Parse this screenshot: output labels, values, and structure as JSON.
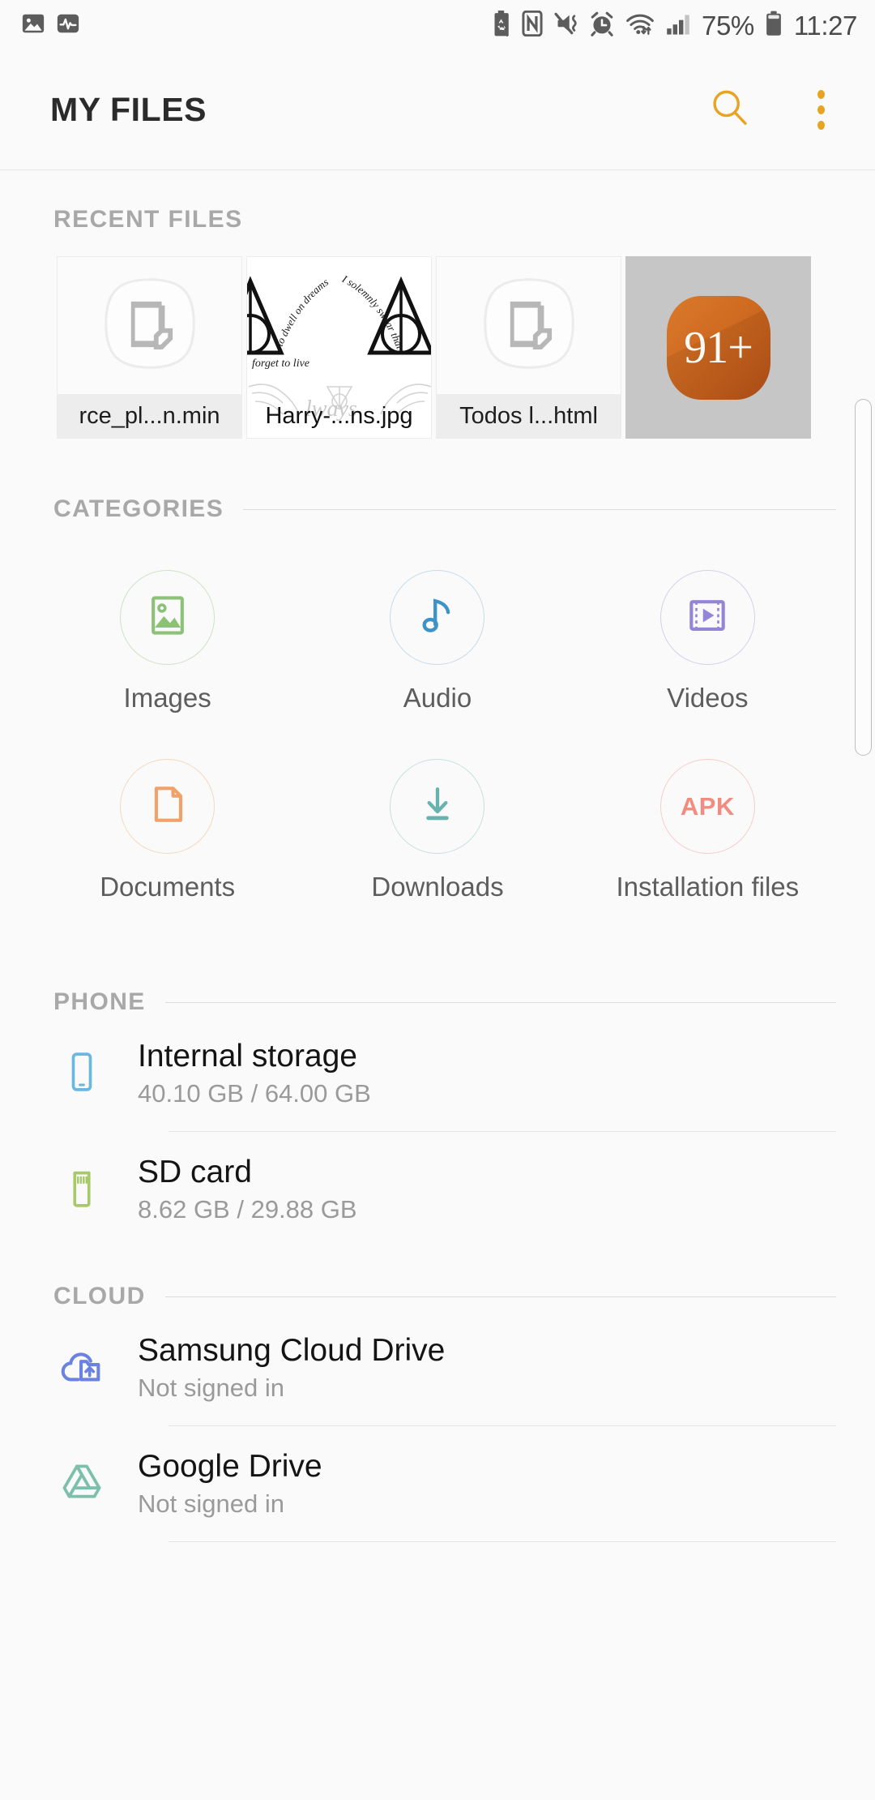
{
  "status_bar": {
    "left_icons": [
      "image-notification-icon",
      "activity-notification-icon"
    ],
    "right_icons": [
      "battery-saver-icon",
      "nfc-icon",
      "mute-vibrate-icon",
      "alarm-icon",
      "wifi-icon",
      "signal-icon"
    ],
    "battery_percent": "75%",
    "time": "11:27"
  },
  "app_bar": {
    "title": "MY FILES",
    "search_icon": "search-icon",
    "overflow_icon": "more-vertical-icon",
    "accent_color": "#e8a322"
  },
  "recent": {
    "label": "RECENT FILES",
    "tiles": [
      {
        "name": "rce_pl...n.min",
        "thumb": "generic-file-icon"
      },
      {
        "name": "Harry-...ns.jpg",
        "thumb": "image-preview"
      },
      {
        "name": "Todos l...html",
        "thumb": "generic-file-icon"
      },
      {
        "name": "",
        "thumb": "more-files-badge",
        "count": "91+"
      }
    ]
  },
  "categories": {
    "label": "CATEGORIES",
    "items": [
      {
        "label": "Images",
        "icon": "image-icon",
        "color": "#8cc178"
      },
      {
        "label": "Audio",
        "icon": "music-note-icon",
        "color": "#3c93c8"
      },
      {
        "label": "Videos",
        "icon": "video-film-icon",
        "color": "#9585d6"
      },
      {
        "label": "Documents",
        "icon": "document-icon",
        "color": "#efa269"
      },
      {
        "label": "Downloads",
        "icon": "download-icon",
        "color": "#69b3ae"
      },
      {
        "label": "Installation files",
        "icon": "apk-icon",
        "color": "#f08d80",
        "badge_text": "APK"
      }
    ]
  },
  "phone": {
    "label": "PHONE",
    "items": [
      {
        "title": "Internal storage",
        "subtitle": "40.10 GB / 64.00 GB",
        "icon": "phone-icon",
        "color": "#6ab7e0"
      },
      {
        "title": "SD card",
        "subtitle": "8.62 GB / 29.88 GB",
        "icon": "sd-card-icon",
        "color": "#a8c96a"
      }
    ]
  },
  "cloud": {
    "label": "CLOUD",
    "items": [
      {
        "title": "Samsung Cloud Drive",
        "subtitle": "Not signed in",
        "icon": "samsung-cloud-icon",
        "color": "#6b82e0"
      },
      {
        "title": "Google Drive",
        "subtitle": "Not signed in",
        "icon": "google-drive-icon",
        "color": "#7cc0ab"
      }
    ]
  }
}
